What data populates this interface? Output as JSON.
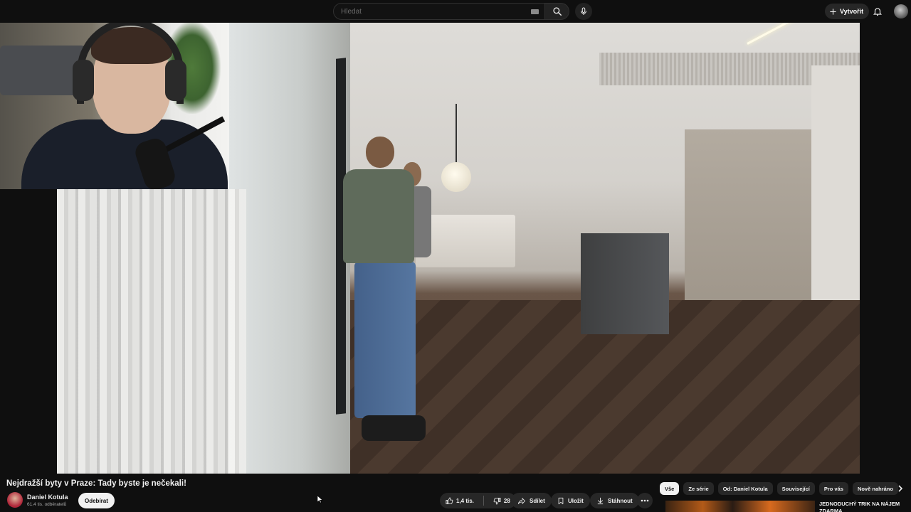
{
  "header": {
    "search_placeholder": "Hledat",
    "create_label": "Vytvořit",
    "icons": [
      "keyboard-icon",
      "search-icon",
      "mic-icon",
      "plus-icon",
      "bell-icon",
      "avatar"
    ]
  },
  "video": {
    "title": "Nejdražší byty v Praze: Tady byste je nečekali!",
    "channel": {
      "name": "Daniel Kotula",
      "subscribers": "61,4 tis. odběratelů"
    },
    "subscribe_label": "Odebírat",
    "actions": {
      "likes": "1,4 tis.",
      "dislikes": "28",
      "share": "Sdílet",
      "save": "Uložit",
      "download": "Stáhnout"
    }
  },
  "chips": [
    {
      "label": "Vše",
      "active": true
    },
    {
      "label": "Ze série",
      "active": false
    },
    {
      "label": "Od: Daniel Kotula",
      "active": false
    },
    {
      "label": "Související",
      "active": false
    },
    {
      "label": "Pro vás",
      "active": false
    },
    {
      "label": "Nově nahráno",
      "active": false
    }
  ],
  "recommendation": {
    "title": "JEDNODUCHÝ TRIK NA NÁJEM ZDARMA"
  },
  "colors": {
    "background": "#0f0f0f",
    "pill": "#272727",
    "text": "#f1f1f1",
    "muted": "#aaaaaa"
  }
}
